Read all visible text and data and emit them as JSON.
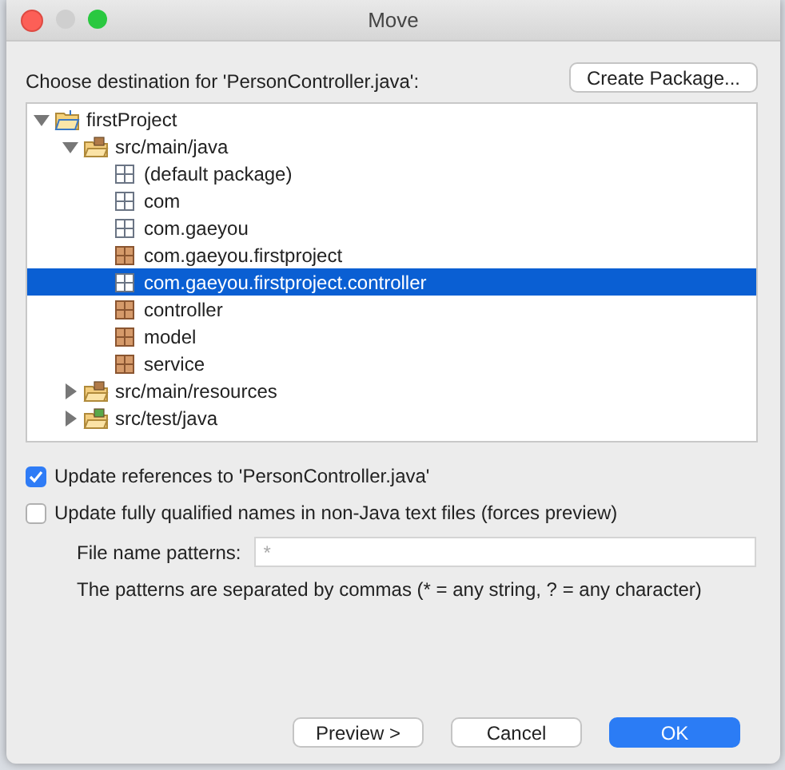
{
  "window": {
    "title": "Move"
  },
  "destination_label": "Choose destination for 'PersonController.java':",
  "create_package_button": "Create Package...",
  "tree": [
    {
      "label": "firstProject",
      "kind": "project",
      "expanded": true,
      "selected": false,
      "children": [
        {
          "label": "src/main/java",
          "kind": "source-folder",
          "expanded": true,
          "selected": false,
          "children": [
            {
              "label": "(default package)",
              "kind": "package",
              "empty": true,
              "selected": false
            },
            {
              "label": "com",
              "kind": "package",
              "empty": true,
              "selected": false
            },
            {
              "label": "com.gaeyou",
              "kind": "package",
              "empty": true,
              "selected": false
            },
            {
              "label": "com.gaeyou.firstproject",
              "kind": "package",
              "empty": false,
              "selected": false
            },
            {
              "label": "com.gaeyou.firstproject.controller",
              "kind": "package",
              "empty": true,
              "selected": true
            },
            {
              "label": "controller",
              "kind": "package",
              "empty": false,
              "selected": false
            },
            {
              "label": "model",
              "kind": "package",
              "empty": false,
              "selected": false
            },
            {
              "label": "service",
              "kind": "package",
              "empty": false,
              "selected": false
            }
          ]
        },
        {
          "label": "src/main/resources",
          "kind": "source-folder",
          "expanded": false,
          "selected": false
        },
        {
          "label": "src/test/java",
          "kind": "test-folder",
          "expanded": false,
          "selected": false
        }
      ]
    }
  ],
  "options": [
    {
      "label": "Update references to 'PersonController.java'",
      "checked": true
    },
    {
      "label": "Update fully qualified names in non-Java text files (forces preview)",
      "checked": false
    }
  ],
  "file_patterns": {
    "label": "File name patterns:",
    "placeholder": "*"
  },
  "patterns_note": "The patterns are separated by commas (* = any string, ? = any character)",
  "buttons": [
    {
      "label": "Preview >",
      "default": false
    },
    {
      "label": "Cancel",
      "default": false
    },
    {
      "label": "OK",
      "default": true
    }
  ]
}
